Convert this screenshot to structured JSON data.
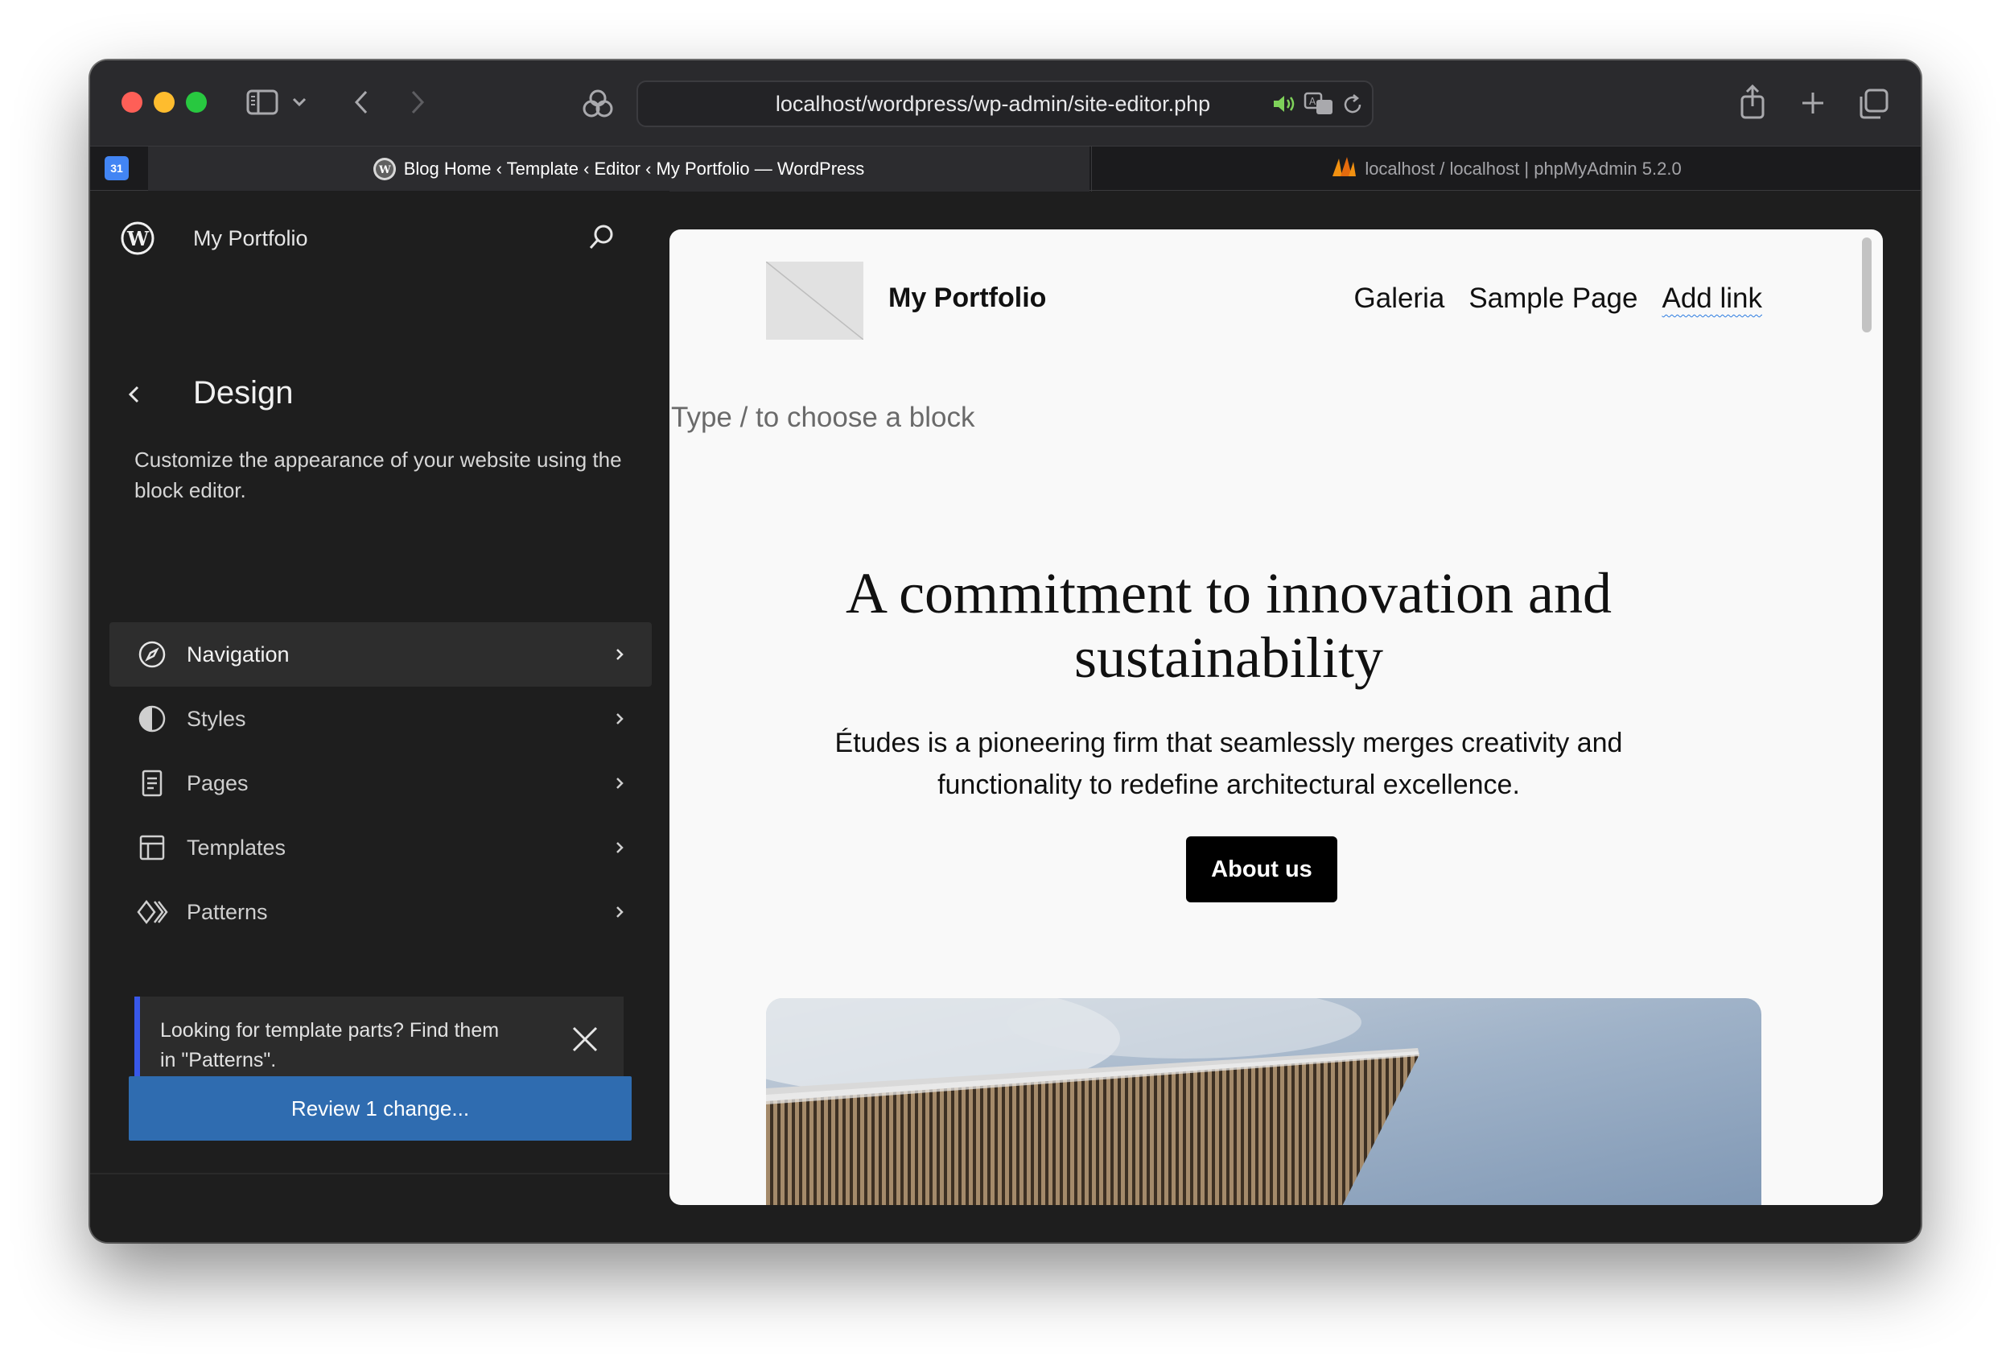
{
  "browser": {
    "url": "localhost/wordpress/wp-admin/site-editor.php",
    "tabs": [
      {
        "title": "Blog Home ‹ Template ‹ Editor ‹ My Portfolio — WordPress",
        "active": true
      },
      {
        "title": "localhost / localhost | phpMyAdmin 5.2.0",
        "active": false
      }
    ],
    "pinned_tab_label": "31"
  },
  "sidebar": {
    "site_name": "My Portfolio",
    "section_title": "Design",
    "description": "Customize the appearance of your website using the block editor.",
    "menu": [
      {
        "label": "Navigation",
        "icon": "navigation-compass-icon",
        "active": true
      },
      {
        "label": "Styles",
        "icon": "styles-half-circle-icon",
        "active": false
      },
      {
        "label": "Pages",
        "icon": "page-icon",
        "active": false
      },
      {
        "label": "Templates",
        "icon": "template-layout-icon",
        "active": false
      },
      {
        "label": "Patterns",
        "icon": "patterns-diamond-icon",
        "active": false
      }
    ],
    "notice": "Looking for template parts? Find them in \"Patterns\".",
    "review_button": "Review 1 change..."
  },
  "canvas": {
    "site_title": "My Portfolio",
    "nav": [
      "Galeria",
      "Sample Page",
      "Add link"
    ],
    "block_placeholder": "Type / to choose a block",
    "heading": "A commitment to innovation and sustainability",
    "text": "Études is a pioneering firm that seamlessly merges creativity and functionality to redefine architectural excellence.",
    "button": "About us"
  },
  "colors": {
    "accent": "#2f6cb0",
    "notice_border": "#3858e9",
    "sidebar_bg": "#1e1e1e",
    "canvas_bg": "#f9f9f9"
  }
}
